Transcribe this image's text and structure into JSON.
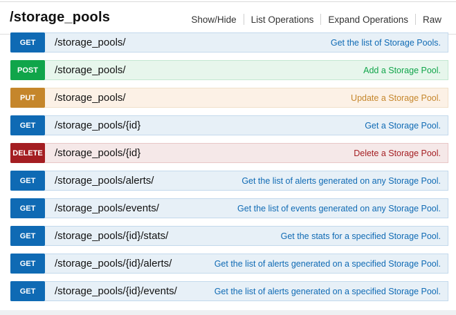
{
  "header": {
    "title": "/storage_pools",
    "links": [
      "Show/Hide",
      "List Operations",
      "Expand Operations",
      "Raw"
    ]
  },
  "endpoints": [
    {
      "method": "GET",
      "path": "/storage_pools/",
      "description": "Get the list of Storage Pools."
    },
    {
      "method": "POST",
      "path": "/storage_pools/",
      "description": "Add a Storage Pool."
    },
    {
      "method": "PUT",
      "path": "/storage_pools/",
      "description": "Update a Storage Pool."
    },
    {
      "method": "GET",
      "path": "/storage_pools/{id}",
      "description": "Get a Storage Pool."
    },
    {
      "method": "DELETE",
      "path": "/storage_pools/{id}",
      "description": "Delete a Storage Pool."
    },
    {
      "method": "GET",
      "path": "/storage_pools/alerts/",
      "description": "Get the list of alerts generated on any Storage Pool."
    },
    {
      "method": "GET",
      "path": "/storage_pools/events/",
      "description": "Get the list of events generated on any Storage Pool."
    },
    {
      "method": "GET",
      "path": "/storage_pools/{id}/stats/",
      "description": "Get the stats for a specified Storage Pool."
    },
    {
      "method": "GET",
      "path": "/storage_pools/{id}/alerts/",
      "description": "Get the list of alerts generated on a specified Storage Pool."
    },
    {
      "method": "GET",
      "path": "/storage_pools/{id}/events/",
      "description": "Get the list of alerts generated on a specified Storage Pool."
    }
  ],
  "colors": {
    "get": "#0f6ab4",
    "post": "#10a54a",
    "put": "#c5862b",
    "delete": "#a41e22"
  }
}
